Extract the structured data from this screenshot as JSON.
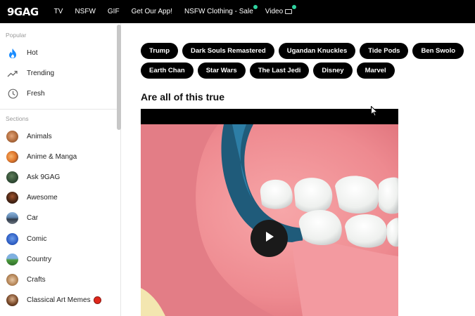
{
  "header": {
    "logo": "9GAG",
    "nav": [
      {
        "label": "TV"
      },
      {
        "label": "NSFW"
      },
      {
        "label": "GIF"
      },
      {
        "label": "Get Our App!"
      },
      {
        "label": "NSFW Clothing - Sale"
      },
      {
        "label": "Video"
      }
    ],
    "dot_color": "#2fd39f"
  },
  "sidebar": {
    "popular_label": "Popular",
    "popular": [
      {
        "label": "Hot",
        "icon": "fire-icon"
      },
      {
        "label": "Trending",
        "icon": "trending-icon"
      },
      {
        "label": "Fresh",
        "icon": "clock-icon"
      }
    ],
    "sections_label": "Sections",
    "sections": [
      {
        "label": "Animals"
      },
      {
        "label": "Anime & Manga"
      },
      {
        "label": "Ask 9GAG"
      },
      {
        "label": "Awesome"
      },
      {
        "label": "Car"
      },
      {
        "label": "Comic"
      },
      {
        "label": "Country"
      },
      {
        "label": "Crafts"
      },
      {
        "label": "Classical Art Memes"
      }
    ]
  },
  "tags": [
    "Trump",
    "Dark Souls Remastered",
    "Ugandan Knuckles",
    "Tide Pods",
    "Ben Swolo",
    "Earth Chan",
    "Star Wars",
    "The Last Jedi",
    "Disney",
    "Marvel"
  ],
  "post": {
    "title": "Are all of this true"
  },
  "colors": {
    "accent_fire": "#1a8cff",
    "badge_red": "#e0271b"
  }
}
